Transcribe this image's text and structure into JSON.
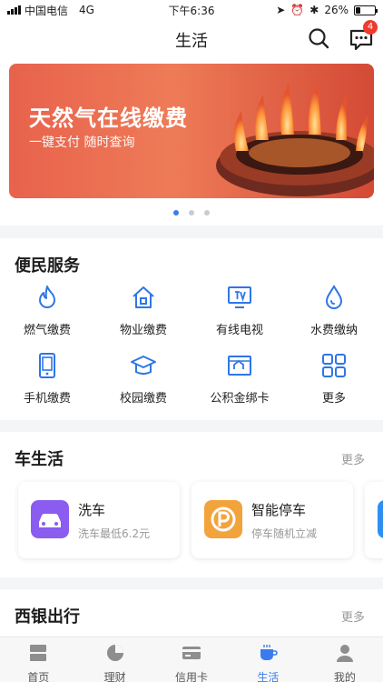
{
  "status_bar": {
    "carrier": "中国电信",
    "network": "4G",
    "time": "下午6:36",
    "battery": "26%",
    "battery_level": 0.26
  },
  "header": {
    "title": "生活",
    "badge_count": "4"
  },
  "banner": {
    "title": "天然气在线缴费",
    "subtitle": "一键支付 随时查询",
    "page_count": 3,
    "active_index": 0
  },
  "services": {
    "title": "便民服务",
    "items": [
      {
        "label": "燃气缴费",
        "icon": "flame-icon"
      },
      {
        "label": "物业缴费",
        "icon": "house-icon"
      },
      {
        "label": "有线电视",
        "icon": "tv-icon"
      },
      {
        "label": "水费缴纳",
        "icon": "water-drop-icon"
      },
      {
        "label": "手机缴费",
        "icon": "phone-icon"
      },
      {
        "label": "校园缴费",
        "icon": "graduation-cap-icon"
      },
      {
        "label": "公积金绑卡",
        "icon": "house-card-icon"
      },
      {
        "label": "更多",
        "icon": "grid-icon"
      }
    ]
  },
  "car_life": {
    "title": "车生活",
    "more": "更多",
    "cards": [
      {
        "title": "洗车",
        "subtitle": "洗车最低6.2元",
        "icon": "car-icon",
        "color": "#8a5cf0"
      },
      {
        "title": "智能停车",
        "subtitle": "停车随机立减",
        "icon": "parking-icon",
        "color": "#f3a33b"
      }
    ]
  },
  "travel": {
    "title": "西银出行",
    "more": "更多"
  },
  "tabs": [
    {
      "label": "首页",
      "icon": "home-icon"
    },
    {
      "label": "理财",
      "icon": "pie-chart-icon"
    },
    {
      "label": "信用卡",
      "icon": "credit-card-icon"
    },
    {
      "label": "生活",
      "icon": "coffee-cup-icon",
      "active": true
    },
    {
      "label": "我的",
      "icon": "person-icon"
    }
  ],
  "colors": {
    "accent": "#3a7bf0",
    "badge": "#f03a2e",
    "icon_blue": "#2f76e6"
  }
}
